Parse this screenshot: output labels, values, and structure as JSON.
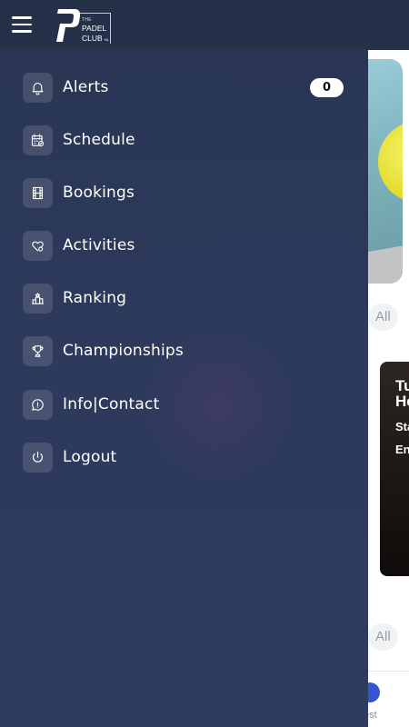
{
  "app": {
    "logo": {
      "line1": "THE",
      "line2": "PADEL",
      "line3": "CLUB",
      "suffix": "NL"
    }
  },
  "menu": {
    "items": [
      {
        "label": "Alerts",
        "icon": "bell-icon",
        "badge": "0"
      },
      {
        "label": "Schedule",
        "icon": "calendar-icon"
      },
      {
        "label": "Bookings",
        "icon": "film-icon"
      },
      {
        "label": "Activities",
        "icon": "heart-icon"
      },
      {
        "label": "Ranking",
        "icon": "podium-icon"
      },
      {
        "label": "Championships",
        "icon": "trophy-icon"
      },
      {
        "label": "Info|Contact",
        "icon": "chat-info-icon"
      },
      {
        "label": "Logout",
        "icon": "power-icon"
      }
    ]
  },
  "background": {
    "filter_chip_1": "All",
    "filter_chip_2": "All",
    "card_title": "Tu\nHe",
    "card_line_1": "Sta",
    "card_line_2": "En",
    "bottom_tab_label": "est"
  },
  "colors": {
    "topbar": "#253049",
    "drawer": "#2d3a5c",
    "accent": "#3454d1"
  }
}
